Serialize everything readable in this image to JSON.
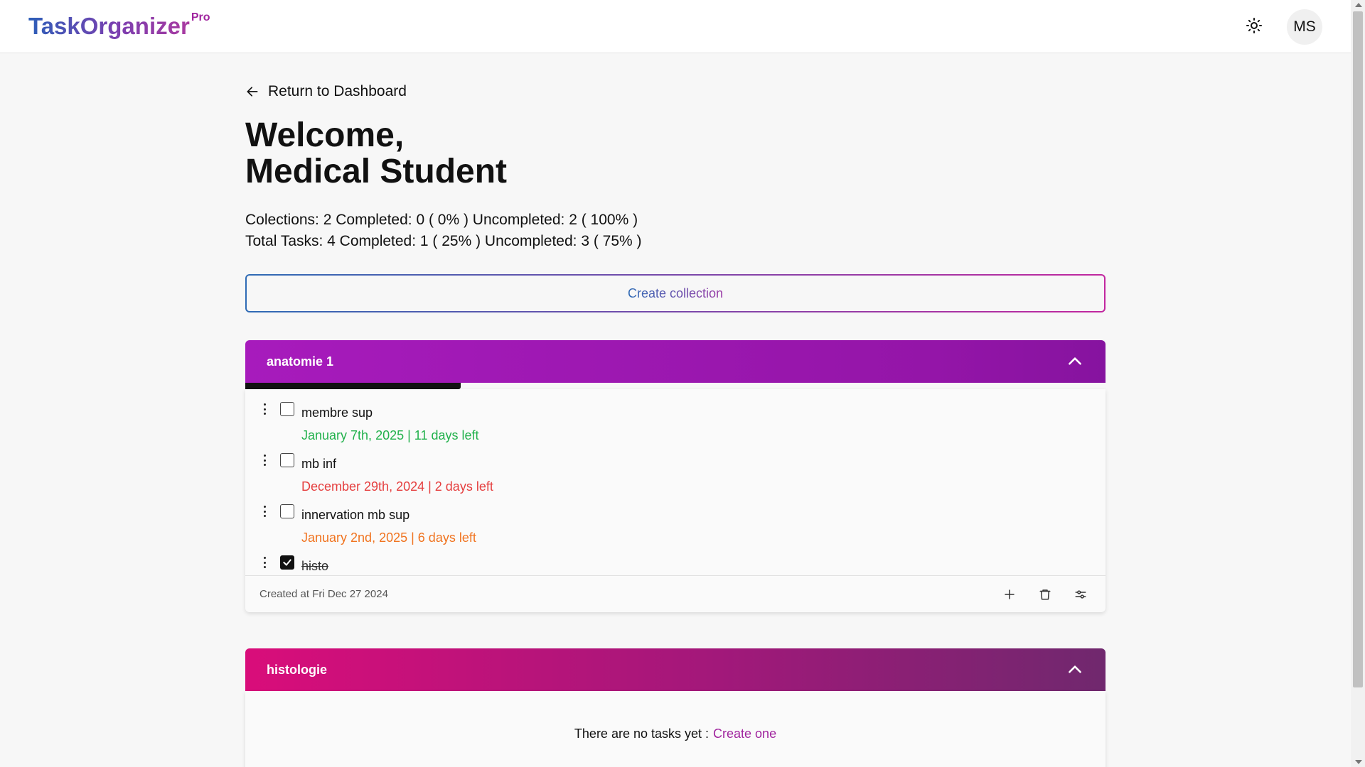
{
  "header": {
    "logo_main": "TaskOrganizer",
    "logo_sup": "Pro",
    "avatar_initials": "MS",
    "theme_icon": "sun-icon"
  },
  "nav": {
    "back_label": "Return to Dashboard"
  },
  "welcome": {
    "line1": "Welcome,",
    "line2": "Medical Student"
  },
  "stats": {
    "collections": "Colections: 2 Completed: 0 ( 0% ) Uncompleted: 2 ( 100% )",
    "tasks": "Total Tasks: 4 Completed: 1 ( 25% ) Uncompleted: 3 ( 75% )"
  },
  "create_collection_label": "Create collection",
  "collections": [
    {
      "name": "anatomie 1",
      "progress_fraction": 0.25,
      "tasks": [
        {
          "title": "membre sup",
          "due": "January 7th, 2025 | 11 days left",
          "due_color": "#22b14c",
          "done": false
        },
        {
          "title": "mb inf",
          "due": "December 29th, 2024 | 2 days left",
          "due_color": "#e53e3e",
          "done": false
        },
        {
          "title": "innervation mb sup",
          "due": "January 2nd, 2025 | 6 days left",
          "due_color": "#f0731f",
          "done": false
        },
        {
          "title": "histo",
          "due": "",
          "done": true
        }
      ],
      "created": "Created at Fri Dec 27 2024"
    },
    {
      "name": "histologie",
      "empty_text": "There are no tasks yet :",
      "empty_link": "Create one"
    }
  ],
  "colors": {
    "accent_pink": "#a0249e",
    "header1_start": "#a71bbc",
    "header2_start": "#d90d7a"
  }
}
